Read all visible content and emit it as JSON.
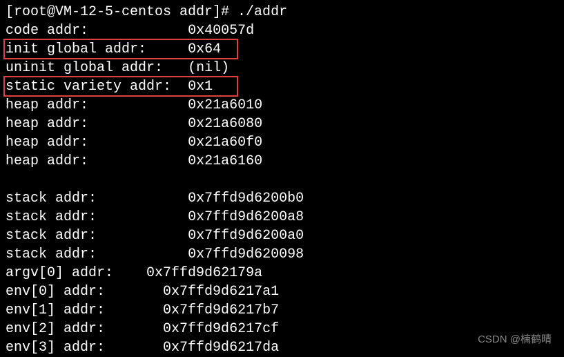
{
  "prompt": "[root@VM-12-5-centos addr]# ./addr",
  "lines": [
    {
      "label": "code addr:",
      "value": "0x40057d"
    },
    {
      "label": "init global addr:",
      "value": "0x64"
    },
    {
      "label": "uninit global addr:",
      "value": "(nil)"
    },
    {
      "label": "static variety addr:",
      "value": "0x1"
    },
    {
      "label": "heap addr:",
      "value": "0x21a6010"
    },
    {
      "label": "heap addr:",
      "value": "0x21a6080"
    },
    {
      "label": "heap addr:",
      "value": "0x21a60f0"
    },
    {
      "label": "heap addr:",
      "value": "0x21a6160"
    },
    {
      "label": "",
      "value": ""
    },
    {
      "label": "stack addr:",
      "value": "0x7ffd9d6200b0"
    },
    {
      "label": "stack addr:",
      "value": "0x7ffd9d6200a8"
    },
    {
      "label": "stack addr:",
      "value": "0x7ffd9d6200a0"
    },
    {
      "label": "stack addr:",
      "value": "0x7ffd9d620098"
    }
  ],
  "argv_env": [
    {
      "label": "argv[0] addr:",
      "value": "0x7ffd9d62179a"
    },
    {
      "label": "env[0] addr:",
      "value": "0x7ffd9d6217a1"
    },
    {
      "label": "env[1] addr:",
      "value": "0x7ffd9d6217b7"
    },
    {
      "label": "env[2] addr:",
      "value": "0x7ffd9d6217cf"
    },
    {
      "label": "env[3] addr:",
      "value": "0x7ffd9d6217da"
    }
  ],
  "watermark": "CSDN @楠鹤晴"
}
